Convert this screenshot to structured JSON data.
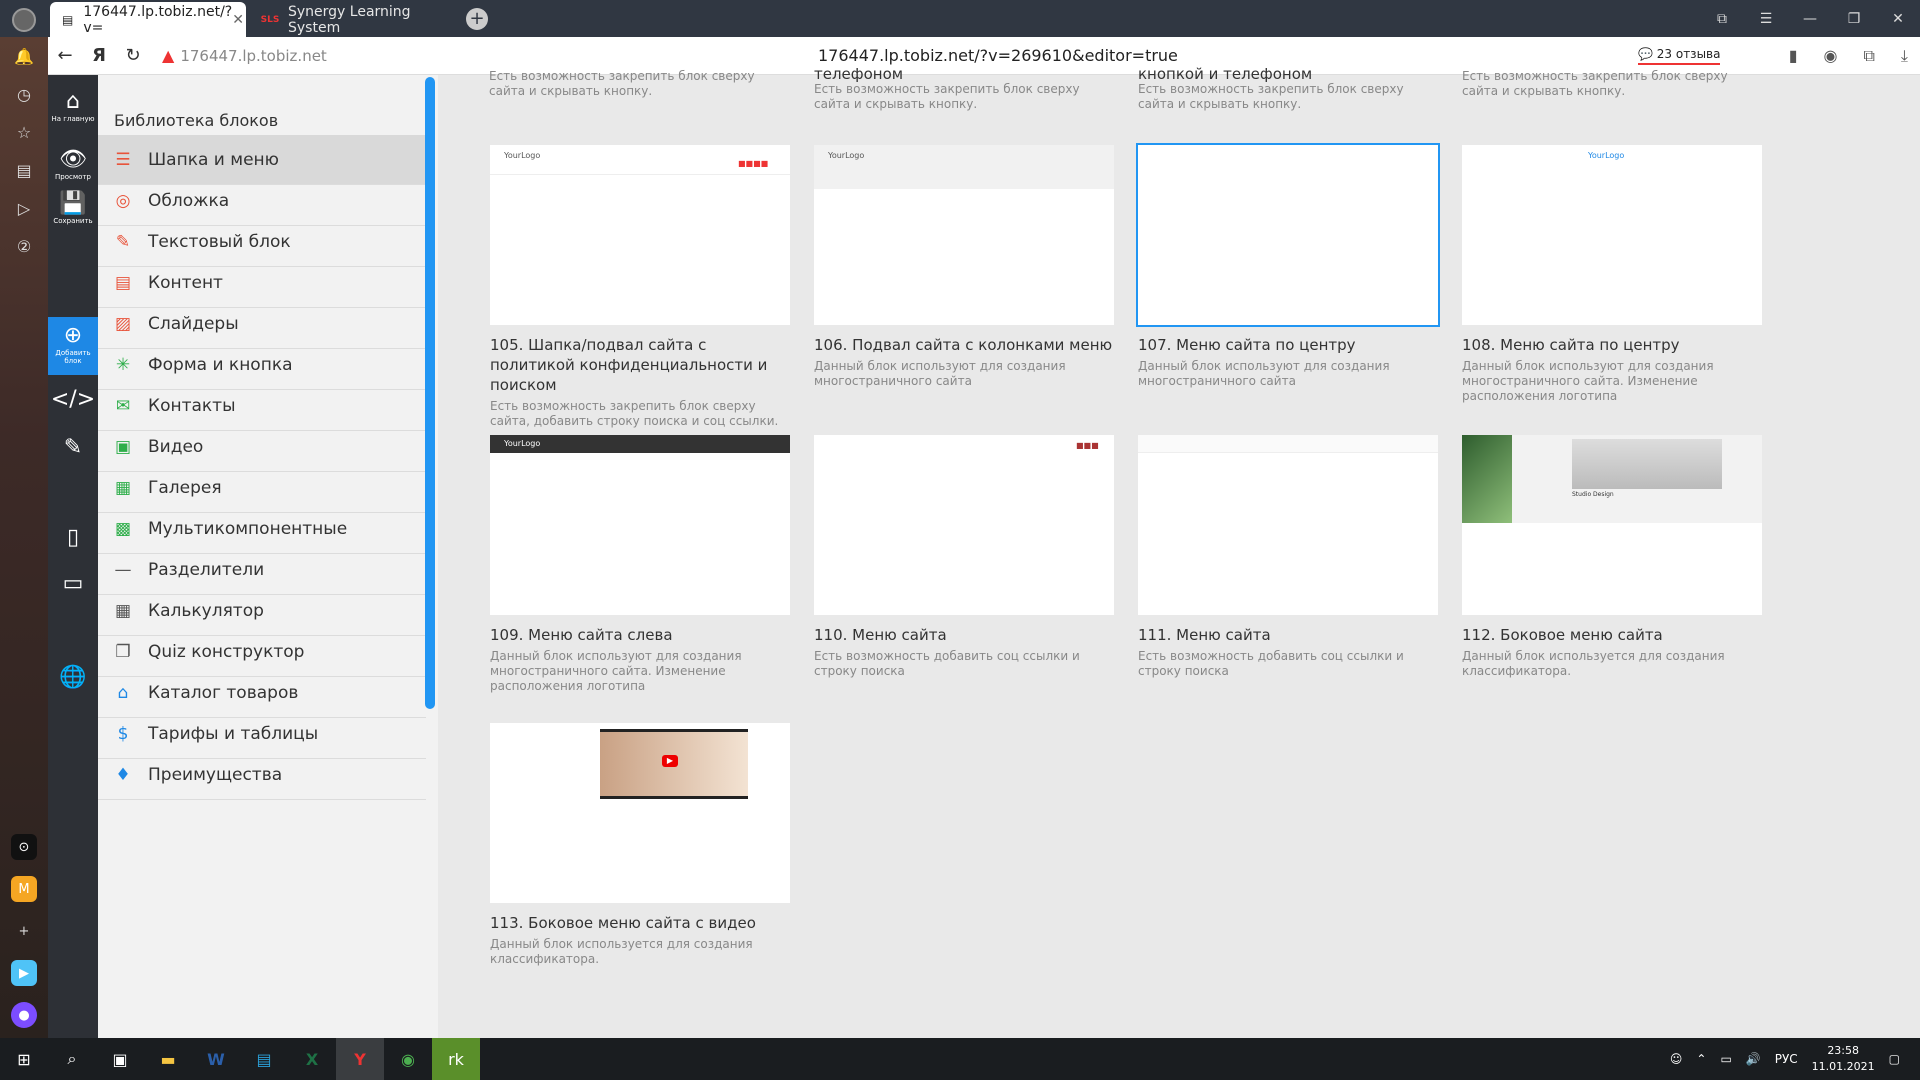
{
  "browser": {
    "tabs": [
      {
        "label": "176447.lp.tobiz.net/?v=",
        "favicon": "doc-icon"
      },
      {
        "label": "Synergy Learning System",
        "favicon": "sls-logo-icon"
      }
    ],
    "domain": "176447.lp.tobiz.net",
    "url": "176447.lp.tobiz.net/?v=269610&editor=true",
    "reviews": "23 отзыва"
  },
  "toolbar": {
    "home": "На главную",
    "preview": "Просмотр",
    "save": "Сохранить",
    "add_block": "Добавить блок"
  },
  "library": {
    "title": "Библиотека блоков",
    "categories": [
      {
        "label": "Шапка и меню",
        "icon": "menu-icon",
        "color": "#e8533a"
      },
      {
        "label": "Обложка",
        "icon": "target-icon",
        "color": "#e8533a"
      },
      {
        "label": "Текстовый блок",
        "icon": "text-icon",
        "color": "#e8533a"
      },
      {
        "label": "Контент",
        "icon": "content-icon",
        "color": "#e8533a"
      },
      {
        "label": "Слайдеры",
        "icon": "slider-icon",
        "color": "#e8533a"
      },
      {
        "label": "Форма и кнопка",
        "icon": "form-icon",
        "color": "#2eae4a"
      },
      {
        "label": "Контакты",
        "icon": "mail-icon",
        "color": "#2eae4a"
      },
      {
        "label": "Видео",
        "icon": "video-icon",
        "color": "#2eae4a"
      },
      {
        "label": "Галерея",
        "icon": "gallery-icon",
        "color": "#2eae4a"
      },
      {
        "label": "Мультикомпонентные",
        "icon": "multi-icon",
        "color": "#2eae4a"
      },
      {
        "label": "Разделители",
        "icon": "divider-icon",
        "color": "#555"
      },
      {
        "label": "Калькулятор",
        "icon": "calculator-icon",
        "color": "#555"
      },
      {
        "label": "Quiz конструктор",
        "icon": "quiz-icon",
        "color": "#555"
      },
      {
        "label": "Каталог товаров",
        "icon": "basket-icon",
        "color": "#1e88e5"
      },
      {
        "label": "Тарифы и таблицы",
        "icon": "dollar-icon",
        "color": "#1e88e5"
      },
      {
        "label": "Преимущества",
        "icon": "diamond-icon",
        "color": "#1e88e5"
      }
    ]
  },
  "top_partial": [
    {
      "line1": "Есть возможность закрепить блок сверху",
      "line2": "сайта и скрывать кнопку."
    },
    {
      "title": "телефоном",
      "line1": "Есть возможность закрепить блок сверху",
      "line2": "сайта и скрывать кнопку."
    },
    {
      "title": "кнопкой и телефоном",
      "line1": "Есть возможность закрепить блок сверху",
      "line2": "сайта и скрывать кнопку."
    },
    {
      "line1": "Есть возможность закрепить блок сверху",
      "line2": "сайта и скрывать кнопку."
    }
  ],
  "blocks": [
    {
      "name": "105. Шапка/подвал сайта с политикой конфиденциальности и поиском",
      "desc": "Есть возможность закрепить блок сверху сайта, добавить строку поиска и соц ссылки."
    },
    {
      "name": "106. Подвал сайта с колонками меню",
      "desc": "Данный блок используют для создания многостраничного сайта"
    },
    {
      "name": "107. Меню сайта по центру",
      "desc": "Данный блок используют для создания многостраничного сайта"
    },
    {
      "name": "108. Меню сайта по центру",
      "desc": "Данный блок используют для создания многостраничного сайта. Изменение расположения логотипа"
    },
    {
      "name": "109. Меню сайта слева",
      "desc": "Данный блок используют для создания многостраничного сайта. Изменение расположения логотипа"
    },
    {
      "name": "110. Меню сайта",
      "desc": "Есть возможность добавить соц ссылки и строку поиска"
    },
    {
      "name": "111. Меню сайта",
      "desc": "Есть возможность добавить соц ссылки и строку поиска"
    },
    {
      "name": "112. Боковое меню сайта",
      "desc": "Данный блок используется для создания классификатора."
    },
    {
      "name": "113. Боковое меню сайта с видео",
      "desc": "Данный блок используется для создания классификатора."
    }
  ],
  "thumb_text": {
    "logo": "YourLogo",
    "studio": "Studio Design"
  },
  "taskbar": {
    "lang": "РУС",
    "time": "23:58",
    "date": "11.01.2021"
  }
}
